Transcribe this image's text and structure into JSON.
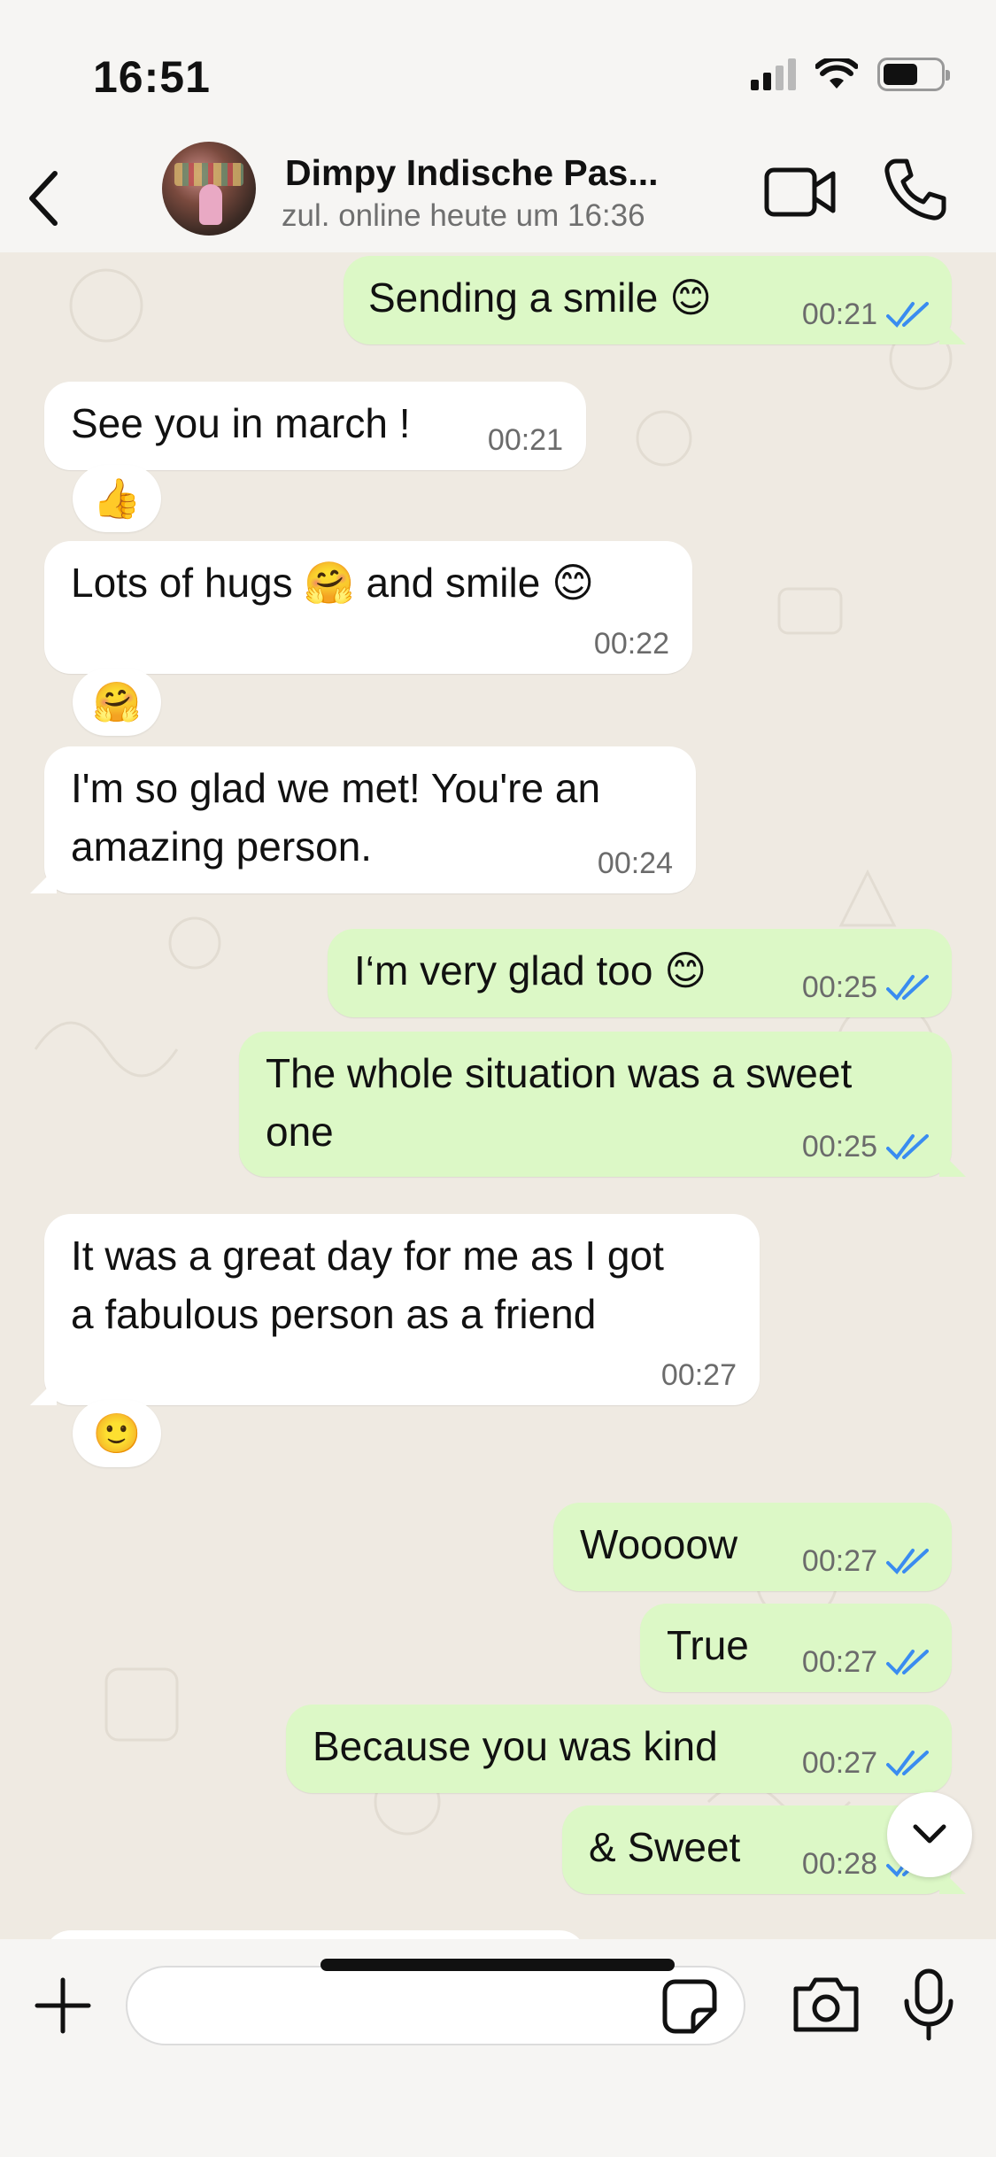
{
  "status_bar": {
    "time": "16:51",
    "icons": [
      "signal-icon",
      "wifi-icon",
      "battery-icon"
    ]
  },
  "header": {
    "contact_name": "Dimpy Indische Pas...",
    "contact_status": "zul. online heute um 16:36",
    "icons": [
      "back-icon",
      "video-call-icon",
      "phone-icon"
    ]
  },
  "messages": [
    {
      "direction": "out",
      "text": "Sending a smile 😊",
      "time": "00:21",
      "read": true
    },
    {
      "direction": "in",
      "text": "See you in march !",
      "time": "00:21",
      "reaction": "👍"
    },
    {
      "direction": "in",
      "text": "Lots of hugs 🤗 and smile 😊",
      "time": "00:22",
      "reaction": "🤗"
    },
    {
      "direction": "in",
      "text": "I'm so glad we met! You're an\namazing person.",
      "time": "00:24"
    },
    {
      "direction": "out",
      "text": "I‘m very glad too 😊",
      "time": "00:25",
      "read": true
    },
    {
      "direction": "out",
      "text": "The whole situation was a sweet\none",
      "time": "00:25",
      "read": true
    },
    {
      "direction": "in",
      "text": "It was a great day for me as I got\na fabulous person as a friend",
      "time": "00:27",
      "reaction": "🙂"
    },
    {
      "direction": "out",
      "text": "Woooow",
      "time": "00:27",
      "read": true
    },
    {
      "direction": "out",
      "text": "True",
      "time": "00:27",
      "read": true
    },
    {
      "direction": "out",
      "text": "Because you was kind",
      "time": "00:27",
      "read": true
    },
    {
      "direction": "out",
      "text": "& Sweet",
      "time": "00:28",
      "read": true
    }
  ],
  "composer": {
    "input_value": "",
    "icons": [
      "plus-icon",
      "sticker-icon",
      "camera-icon",
      "mic-icon"
    ]
  },
  "colors": {
    "outgoing_bubble": "#dcf8c6",
    "incoming_bubble": "#ffffff",
    "chat_background": "#efeae2",
    "read_ticks": "#3a8cf0"
  }
}
